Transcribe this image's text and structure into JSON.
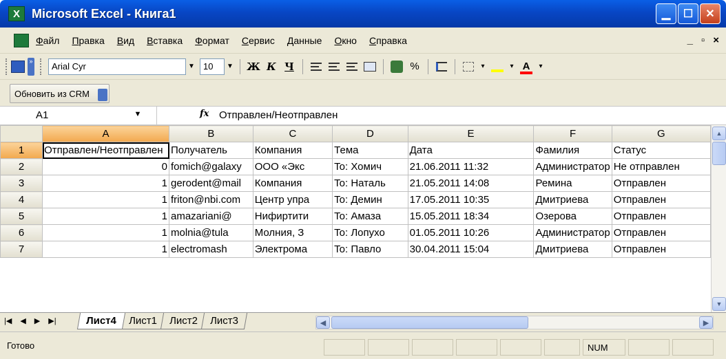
{
  "window": {
    "title": "Microsoft Excel - Книга1"
  },
  "menu": {
    "items": [
      "Файл",
      "Правка",
      "Вид",
      "Вставка",
      "Формат",
      "Сервис",
      "Данные",
      "Окно",
      "Справка"
    ]
  },
  "toolbar": {
    "font_name": "Arial Cyr",
    "font_size": "10",
    "bold": "Ж",
    "italic": "К",
    "underline": "Ч",
    "percent": "%",
    "font_color_letter": "A"
  },
  "crm_toolbar": {
    "button_label": "Обновить из CRM"
  },
  "formula_bar": {
    "cell_ref": "A1",
    "fx": "fx",
    "value": "Отправлен/Неотправлен"
  },
  "grid": {
    "columns": [
      "A",
      "B",
      "C",
      "D",
      "E",
      "F",
      "G"
    ],
    "rows": [
      {
        "num": "1",
        "cells": [
          "Отправлен/Неотправлен",
          "Получатель",
          "Компания",
          "Тема",
          "Дата",
          "Фамилия",
          "Статус"
        ]
      },
      {
        "num": "2",
        "cells": [
          "0",
          "fomich@galaxy",
          "ООО «Экс",
          "To: Хомич",
          "21.06.2011 11:32",
          "Администратор",
          "Не отправлен"
        ]
      },
      {
        "num": "3",
        "cells": [
          "1",
          "gerodent@mail",
          "Компания ",
          "To: Наталь",
          "21.05.2011 14:08",
          "Ремина",
          "Отправлен"
        ]
      },
      {
        "num": "4",
        "cells": [
          "1",
          "friton@nbi.com",
          "Центр упра",
          "To: Демин",
          "17.05.2011 10:35",
          "Дмитриева",
          "Отправлен"
        ]
      },
      {
        "num": "5",
        "cells": [
          "1",
          "amazariani@",
          "Нифиртити",
          "To: Амаза",
          "15.05.2011 18:34",
          "Озерова",
          "Отправлен"
        ]
      },
      {
        "num": "6",
        "cells": [
          "1",
          "molnia@tula",
          "Молния, З",
          "To: Лопухо",
          "01.05.2011 10:26",
          "Администратор",
          "Отправлен"
        ]
      },
      {
        "num": "7",
        "cells": [
          "1",
          "electromash",
          "Электрома",
          "To: Павло",
          "30.04.2011 15:04",
          "Дмитриева",
          "Отправлен"
        ]
      }
    ]
  },
  "sheet_tabs": [
    "Лист4",
    "Лист1",
    "Лист2",
    "Лист3"
  ],
  "active_sheet": "Лист4",
  "status": {
    "ready": "Готово",
    "num": "NUM"
  }
}
